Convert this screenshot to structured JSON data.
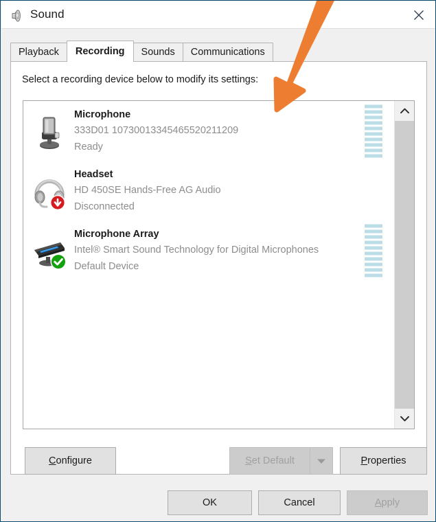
{
  "window": {
    "title": "Sound",
    "app_icon": "speaker-icon",
    "close_label": "✕",
    "border_color": "#0a4a6e",
    "accent_color": "#0078d7"
  },
  "tabs": [
    {
      "label": "Playback",
      "active": false
    },
    {
      "label": "Recording",
      "active": true
    },
    {
      "label": "Sounds",
      "active": false
    },
    {
      "label": "Communications",
      "active": false
    }
  ],
  "panel": {
    "instruction": "Select a recording device below to modify its settings:"
  },
  "devices": [
    {
      "icon": "desktop-microphone-icon",
      "badge": "none",
      "name": "Microphone",
      "description": "333D01 10730013345465520211209",
      "status": "Ready",
      "meter_visible": true,
      "meter_segments": 10,
      "meter_color": "#bcdde6"
    },
    {
      "icon": "headset-icon",
      "badge": "disconnected-down-arrow",
      "badge_color": "#d71920",
      "name": "Headset",
      "description": "HD 450SE Hands-Free AG Audio",
      "status": "Disconnected",
      "meter_visible": false,
      "meter_segments": 0,
      "meter_color": "#bcdde6"
    },
    {
      "icon": "microphone-array-icon",
      "badge": "default-device-check",
      "badge_color": "#13a10e",
      "name": "Microphone Array",
      "description": "Intel® Smart Sound Technology for Digital Microphones",
      "status": "Default Device",
      "meter_visible": true,
      "meter_segments": 10,
      "meter_color": "#bcdde6"
    }
  ],
  "scrollbar": {
    "up_arrow": "chevron-up-icon",
    "down_arrow": "chevron-down-icon"
  },
  "actions": {
    "configure": {
      "label": "Configure",
      "accesskey": "C",
      "enabled": true
    },
    "set_default": {
      "label": "Set Default",
      "accesskey": "S",
      "enabled": false,
      "dropdown_icon": "caret-down-icon"
    },
    "properties": {
      "label": "Properties",
      "accesskey": "P",
      "enabled": true
    }
  },
  "footer": {
    "ok": {
      "label": "OK",
      "enabled": true
    },
    "cancel": {
      "label": "Cancel",
      "enabled": true
    },
    "apply": {
      "label": "Apply",
      "accesskey": "A",
      "enabled": false
    }
  },
  "annotation": {
    "type": "arrow",
    "color": "#ED7D31",
    "points_to": "microphone-device-row"
  }
}
